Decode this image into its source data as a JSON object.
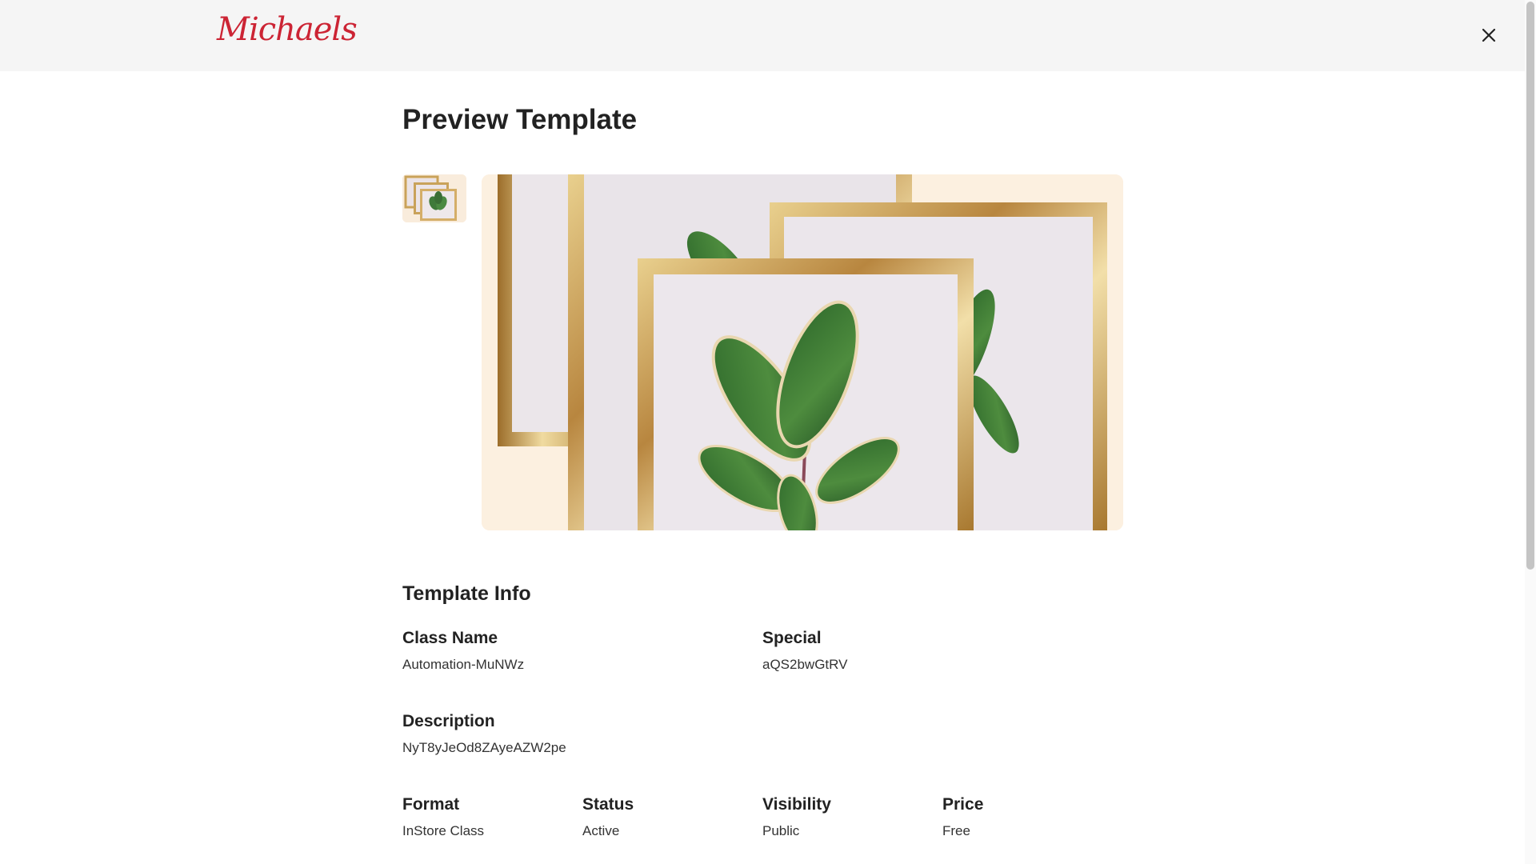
{
  "header": {
    "logo_text": "Michaels",
    "close_icon": "close-icon"
  },
  "page": {
    "title": "Preview Template"
  },
  "gallery": {
    "thumbnail_alt": "gold-frames-with-leaf-thumbnail",
    "main_image_alt": "gold-frames-with-rubber-plant-leaves"
  },
  "info": {
    "section_title": "Template Info",
    "class_name": {
      "label": "Class Name",
      "value": "Automation-MuNWz"
    },
    "special": {
      "label": "Special",
      "value": "aQS2bwGtRV"
    },
    "description": {
      "label": "Description",
      "value": "NyT8yJeOd8ZAyeAZW2pe"
    },
    "format": {
      "label": "Format",
      "value": "InStore Class"
    },
    "status": {
      "label": "Status",
      "value": "Active"
    },
    "visibility": {
      "label": "Visibility",
      "value": "Public"
    },
    "price": {
      "label": "Price",
      "value": "Free"
    }
  },
  "colors": {
    "brand": "#cc2434",
    "header_bg": "#f5f5f5",
    "text": "#222222"
  }
}
